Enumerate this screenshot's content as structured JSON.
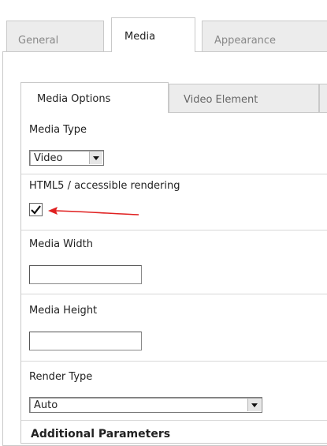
{
  "top_tabs": [
    {
      "label": "General",
      "active": false
    },
    {
      "label": "Media",
      "active": true
    },
    {
      "label": "Appearance",
      "active": false
    }
  ],
  "inner_tabs": [
    {
      "label": "Media Options",
      "active": true
    },
    {
      "label": "Video Element",
      "active": false
    }
  ],
  "fields": {
    "media_type": {
      "label": "Media Type",
      "value": "Video"
    },
    "html5": {
      "label": "HTML5 / accessible rendering",
      "checked": true
    },
    "media_width": {
      "label": "Media Width",
      "value": ""
    },
    "media_height": {
      "label": "Media Height",
      "value": ""
    },
    "render_type": {
      "label": "Render Type",
      "value": "Auto"
    }
  },
  "section_heading": "Additional Parameters",
  "icons": {
    "dropdown": "chevron-down-icon",
    "checkmark": "checkmark-icon",
    "annotation": "red-arrow-icon"
  },
  "colors": {
    "arrow": "#e02020",
    "border": "#c9c9c9",
    "inactive_tab": "#ececec"
  }
}
